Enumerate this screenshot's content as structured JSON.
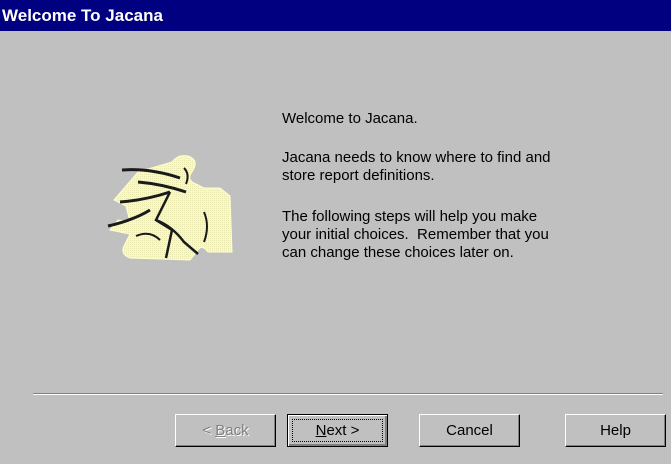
{
  "window": {
    "title": "Welcome To Jacana"
  },
  "content": {
    "welcome_line": "Welcome to Jacana.",
    "needs_line_1": "Jacana needs to know where to find and",
    "needs_line_2": "store report definitions.",
    "steps_line_1": "The following steps will help you make",
    "steps_line_2": "your initial choices.  Remember that you",
    "steps_line_3": "can change these choices later on.",
    "illustration_icon": "puzzle-piece-icon"
  },
  "buttons": {
    "back_prefix": "< ",
    "back_mnemonic": "B",
    "back_rest": "ack",
    "back_enabled": false,
    "next_mnemonic": "N",
    "next_rest": "ext >",
    "cancel_label": "Cancel",
    "help_label": "Help"
  },
  "colors": {
    "titlebar": "#000080",
    "face": "#c0c0c0",
    "puzzle_fill": "#ffff99"
  }
}
